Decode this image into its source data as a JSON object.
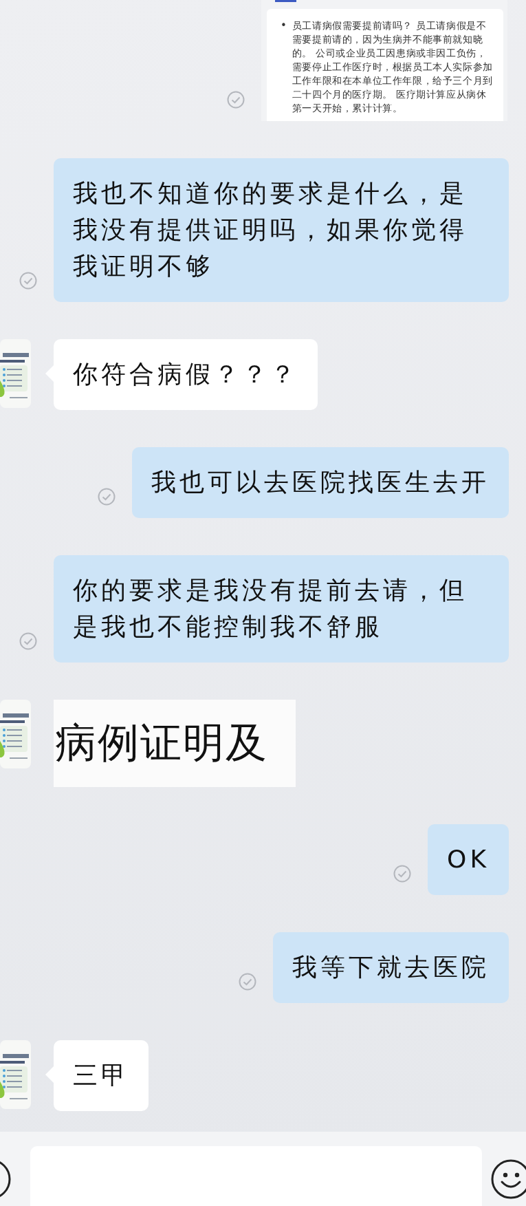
{
  "messages": [
    {
      "kind": "document",
      "outgoing": true,
      "bullet": "•",
      "text": "员工请病假需要提前请吗？ 员工请病假是不需要提前请的，因为生病并不能事前就知晓的。 公司或企业员工因患病或非因工负伤，需要停止工作医疗时，根据员工本人实际参加工作年限和在本单位工作年限，给予三个月到二十四个月的医疗期。 医疗期计算应从病休第一天开始，累计计算。"
    },
    {
      "kind": "text",
      "outgoing": true,
      "text": "我也不知道你的要求是什么，是我没有提供证明吗，如果你觉得我证明不够"
    },
    {
      "kind": "text",
      "outgoing": false,
      "text": "你符合病假？？？"
    },
    {
      "kind": "text",
      "outgoing": true,
      "text": "我也可以去医院找医生去开"
    },
    {
      "kind": "text",
      "outgoing": true,
      "text": "你的要求是我没有提前去请，但是我也不能控制我不舒服"
    },
    {
      "kind": "image_text",
      "outgoing": false,
      "text": "病例证明及"
    },
    {
      "kind": "text",
      "outgoing": true,
      "text": "OK"
    },
    {
      "kind": "text",
      "outgoing": true,
      "text": "我等下就去医院"
    },
    {
      "kind": "text",
      "outgoing": false,
      "text": "三甲"
    }
  ]
}
